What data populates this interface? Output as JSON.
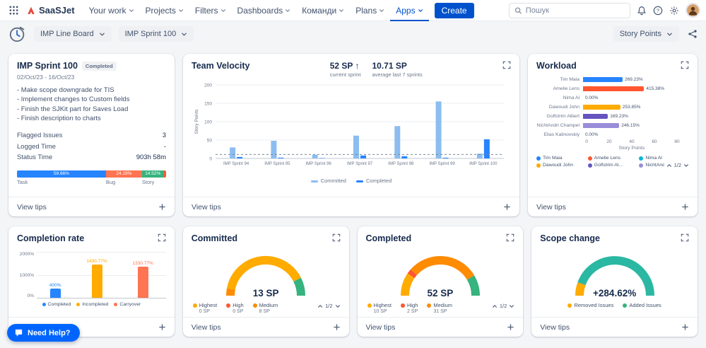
{
  "navbar": {
    "logo_text": "SaaSJet",
    "menu_items": [
      {
        "id": "your-work",
        "label": "Your work"
      },
      {
        "id": "projects",
        "label": "Projects"
      },
      {
        "id": "filters",
        "label": "Filters"
      },
      {
        "id": "dashboards",
        "label": "Dashboards"
      },
      {
        "id": "teams",
        "label": "Команди"
      },
      {
        "id": "plans",
        "label": "Plans"
      },
      {
        "id": "apps",
        "label": "Apps"
      }
    ],
    "active_item": "Apps",
    "create_button": "Create",
    "search_placeholder": "Пошук",
    "right_icons": [
      "notifications-icon",
      "help-icon",
      "settings-icon",
      "profile-avatar"
    ]
  },
  "toolbar": {
    "board_dropdown": "IMP Line Board",
    "sprint_dropdown": "IMP Sprint 100",
    "metric_dropdown": "Story Points",
    "right_icons": [
      "share-icon"
    ]
  },
  "common": {
    "view_tips": "View tips"
  },
  "sprint_card": {
    "title": "IMP Sprint 100",
    "badge": "Completed",
    "date_range": "02/Oct/23 - 16/Oct/23",
    "goals": [
      "- Make scope downgrade for TIS",
      "- Implement changes to Custom fields",
      "- Finish the SJKit part for Saves Load",
      "- Finish description to charts"
    ],
    "stats": [
      {
        "label": "Flagged Issues",
        "value": "3"
      },
      {
        "label": "Logged Time",
        "value": "-"
      },
      {
        "label": "Status Time",
        "value": "903h 58m"
      }
    ],
    "type_bar": [
      {
        "label": "Task",
        "pct": 59.66,
        "text": "59.66%",
        "color": "#2684ff"
      },
      {
        "label": "Bug",
        "pct": 24.19,
        "text": "24.19%",
        "color": "#ff7452"
      },
      {
        "label": "Story",
        "pct": 14.52,
        "text": "14.52%",
        "color": "#36b37e"
      },
      {
        "label": "",
        "pct": 1.63,
        "text": "",
        "color": "#ff5630"
      }
    ]
  },
  "velocity_card": {
    "title": "Team Velocity",
    "kpi1": {
      "value": "52 SP",
      "arrow": "↑",
      "caption": "current sprint"
    },
    "kpi2": {
      "value": "10.71 SP",
      "caption": "average last 7 sprints"
    },
    "chart_data": {
      "type": "bar",
      "categories": [
        "IMP Sprint 94",
        "IMP Sprint 95",
        "IMP Sprint 96",
        "IMP Sprint 97",
        "IMP Sprint 98",
        "IMP Sprint 99",
        "IMP Sprint 100"
      ],
      "series": [
        {
          "name": "Committed",
          "color": "#8bbdf0",
          "values": [
            30,
            48,
            10,
            62,
            88,
            155,
            13
          ]
        },
        {
          "name": "Completed",
          "color": "#2684ff",
          "values": [
            4,
            2,
            1,
            8,
            6,
            2,
            52
          ]
        }
      ],
      "ylabel": "Story Points",
      "yticks": [
        0,
        50,
        100,
        150,
        200
      ],
      "ylim": [
        0,
        200
      ],
      "average_line": 10.71,
      "legend_position": "bottom"
    }
  },
  "workload_card": {
    "title": "Workload",
    "chart_data": {
      "type": "bar-horizontal",
      "xlabel": "Story Points",
      "xticks": [
        0,
        20,
        40,
        60,
        80
      ],
      "xlim": [
        0,
        80
      ],
      "rows": [
        {
          "name": "Tim Maia",
          "value": 35,
          "label": "269.23%",
          "color": "#2684ff"
        },
        {
          "name": "Amelie Lens",
          "value": 54,
          "label": "415.38%",
          "color": "#ff5630"
        },
        {
          "name": "Nima Al",
          "value": 0,
          "label": "0.00%",
          "color": "#00b8d9"
        },
        {
          "name": "Dawoudi John",
          "value": 33,
          "label": "253.85%",
          "color": "#ffab00"
        },
        {
          "name": "Golfstrim Albert",
          "value": 22,
          "label": "169.23%",
          "color": "#6554c0"
        },
        {
          "name": "NichtAndri Champel",
          "value": 32,
          "label": "246.15%",
          "color": "#998dd9"
        },
        {
          "name": "Elias Kalinovskiy",
          "value": 0,
          "label": "0.00%",
          "color": "#57d9a3"
        }
      ]
    },
    "legend": [
      {
        "name": "Tim Maia",
        "color": "#2684ff"
      },
      {
        "name": "Amelie Lens",
        "color": "#ff5630"
      },
      {
        "name": "Nima Al",
        "color": "#00b8d9"
      },
      {
        "name": "Dawoudi John",
        "color": "#ffab00"
      },
      {
        "name": "Golfstrim Al...",
        "color": "#6554c0"
      },
      {
        "name": "NichtAndrii...",
        "color": "#998dd9"
      }
    ],
    "pagination": "1/2"
  },
  "completion_card": {
    "title": "Completion rate",
    "chart_data": {
      "type": "bar",
      "categories": [
        "Completed",
        "Incompleted",
        "Carryover"
      ],
      "values": [
        400,
        1430.77,
        1330.77
      ],
      "labels": [
        "400%",
        "1430.77%",
        "1330.77%"
      ],
      "colors": [
        "#2684ff",
        "#ffab00",
        "#ff7452"
      ],
      "yticks": [
        "0%",
        "1000%",
        "2000%"
      ],
      "ylim": [
        0,
        2000
      ]
    },
    "legend": [
      {
        "name": "Completed",
        "color": "#2684ff"
      },
      {
        "name": "Incompleted",
        "color": "#ffab00"
      },
      {
        "name": "Carryover",
        "color": "#ff7452"
      }
    ]
  },
  "committed_card": {
    "title": "Committed",
    "chart_data": {
      "type": "gauge",
      "value": "13 SP",
      "segments": [
        {
          "color": "#ff8b00",
          "frac": 0.06
        },
        {
          "color": "#ffab00",
          "frac": 0.79
        },
        {
          "color": "#36b37e",
          "frac": 0.15
        }
      ]
    },
    "legend": [
      {
        "name": "Highest",
        "value": "0 SP",
        "color": "#ffab00"
      },
      {
        "name": "High",
        "value": "0 SP",
        "color": "#ff5630"
      },
      {
        "name": "Medium",
        "value": "8 SP",
        "color": "#ff8b00"
      }
    ],
    "pagination": "1/2"
  },
  "completed_card": {
    "title": "Completed",
    "chart_data": {
      "type": "gauge",
      "value": "52 SP",
      "segments": [
        {
          "color": "#ffab00",
          "frac": 0.19
        },
        {
          "color": "#ff5630",
          "frac": 0.04
        },
        {
          "color": "#ff8b00",
          "frac": 0.6
        },
        {
          "color": "#36b37e",
          "frac": 0.17
        }
      ]
    },
    "legend": [
      {
        "name": "Highest",
        "value": "10 SP",
        "color": "#ffab00"
      },
      {
        "name": "High",
        "value": "2 SP",
        "color": "#ff5630"
      },
      {
        "name": "Medium",
        "value": "31 SP",
        "color": "#ff8b00"
      }
    ],
    "pagination": "1/2"
  },
  "scope_card": {
    "title": "Scope change",
    "chart_data": {
      "type": "gauge",
      "value": "+284.62%",
      "segments": [
        {
          "color": "#ffab00",
          "frac": 0.11
        },
        {
          "color": "#2bb8a3",
          "frac": 0.89
        }
      ]
    },
    "legend": [
      {
        "name": "Removed Issues",
        "color": "#ffab00"
      },
      {
        "name": "Added Issues",
        "color": "#36b37e"
      }
    ]
  },
  "help_button": "Need Help?"
}
